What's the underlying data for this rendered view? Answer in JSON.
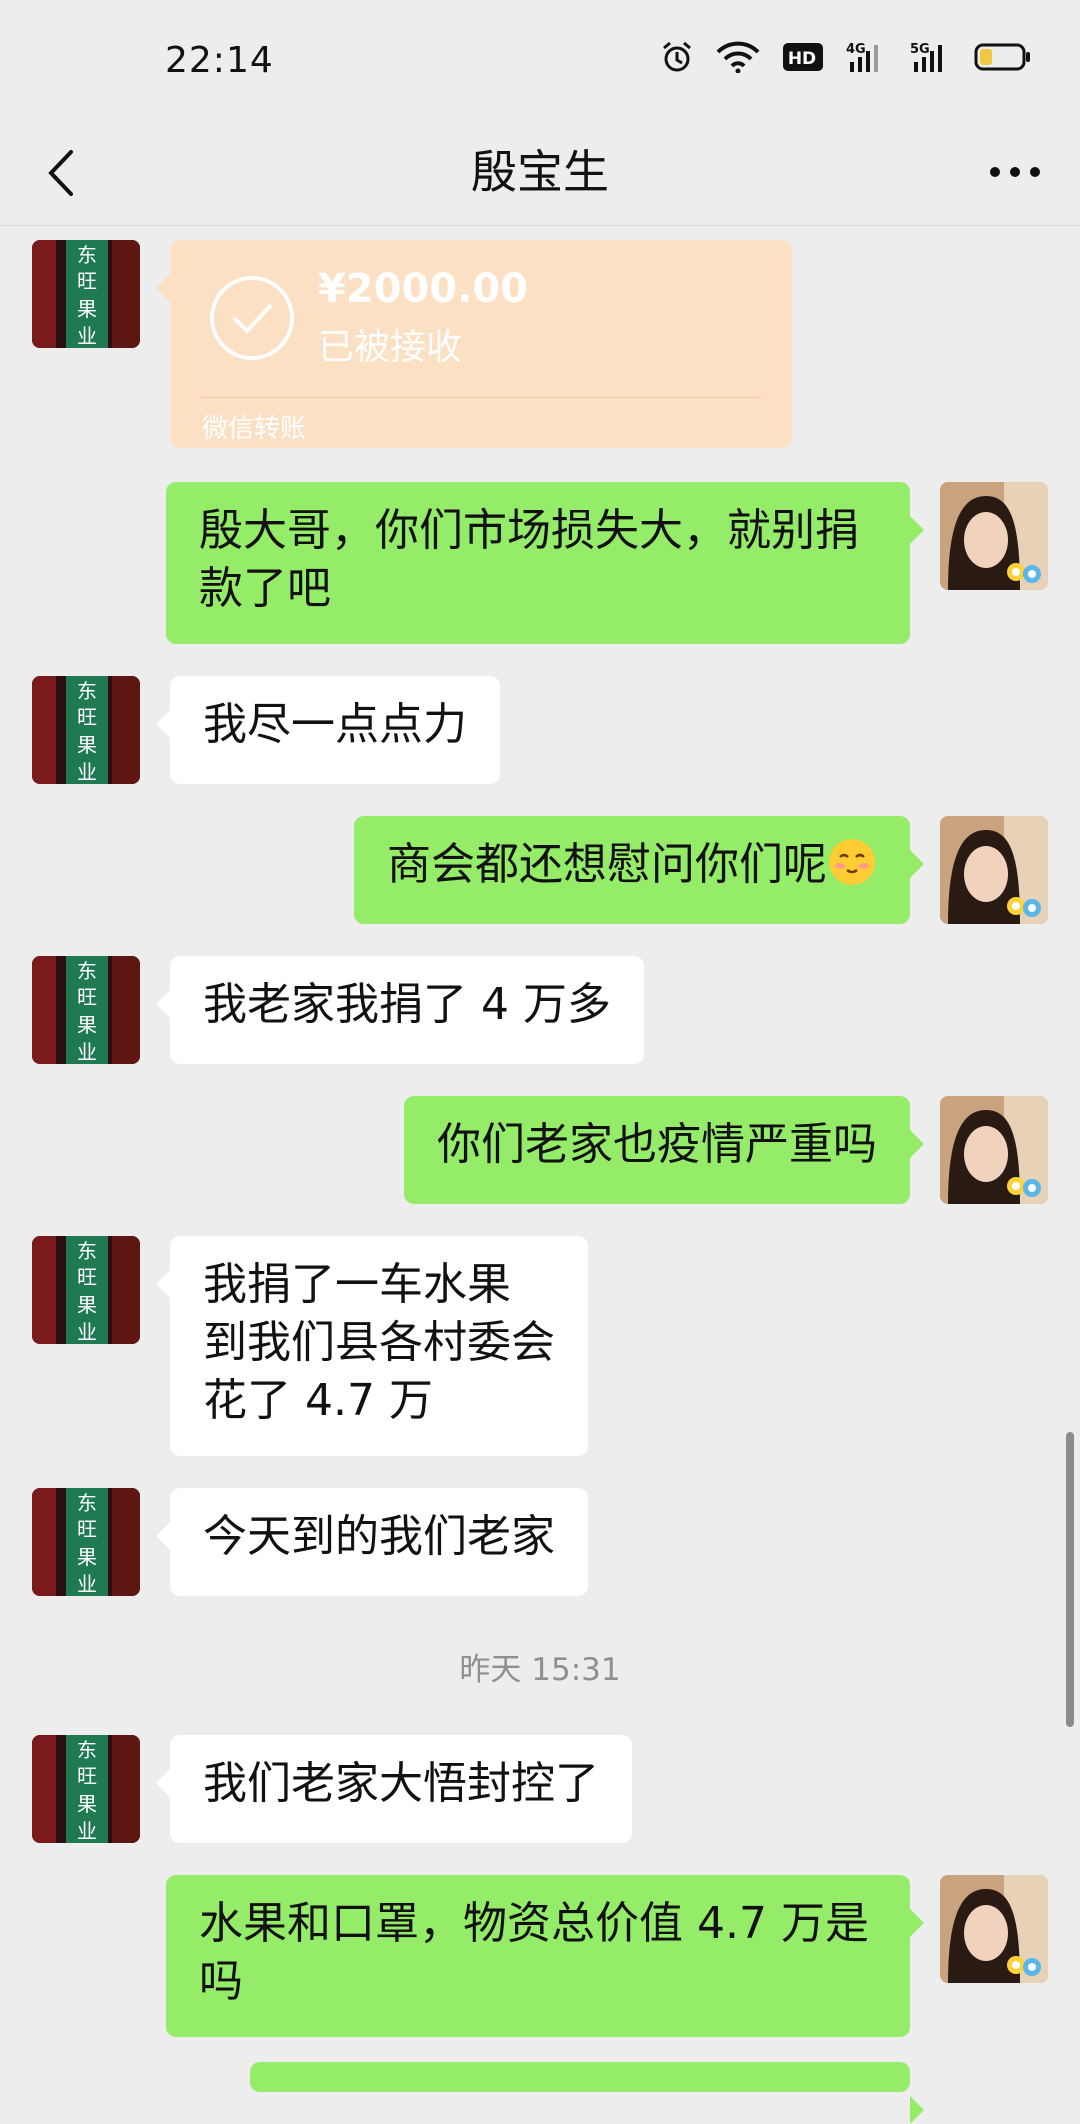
{
  "status_bar": {
    "time": "22:14",
    "icons": [
      "alarm-icon",
      "wifi-icon",
      "hd-icon",
      "signal-4g-icon",
      "signal-5g-icon",
      "battery-icon"
    ],
    "network_1": "4G",
    "network_2": "5G",
    "hd_label": "HD"
  },
  "header": {
    "title": "殷宝生",
    "back_icon": "chevron-left-icon",
    "more_icon": "more-icon"
  },
  "transfer": {
    "amount": "¥2000.00",
    "status": "已被接收",
    "label": "微信转账",
    "background": "#fbe0c3"
  },
  "messages": [
    {
      "sender": "me",
      "text": "殷大哥，你们市场损失大，就别捐\n款了吧"
    },
    {
      "sender": "them",
      "text": "我尽一点点力"
    },
    {
      "sender": "me",
      "text": "商会都还想慰问你们呢",
      "emoji": "blush-emoji"
    },
    {
      "sender": "them",
      "text": "我老家我捐了 4 万多"
    },
    {
      "sender": "me",
      "text": "你们老家也疫情严重吗"
    },
    {
      "sender": "them",
      "text": "我捐了一车水果\n到我们县各村委会\n花了 4.7 万"
    },
    {
      "sender": "them",
      "text": "今天到的我们老家"
    },
    {
      "sender": "them",
      "text": "我们老家大悟封控了"
    },
    {
      "sender": "me",
      "text": "水果和口罩，物资总价值 4.7 万是\n吗"
    }
  ],
  "timestamp": "昨天 15:31",
  "avatar_left": {
    "sign_chars": [
      "东",
      "旺",
      "果",
      "业"
    ]
  },
  "colors": {
    "background": "#ededed",
    "my_bubble": "#95ec69",
    "their_bubble": "#ffffff"
  }
}
